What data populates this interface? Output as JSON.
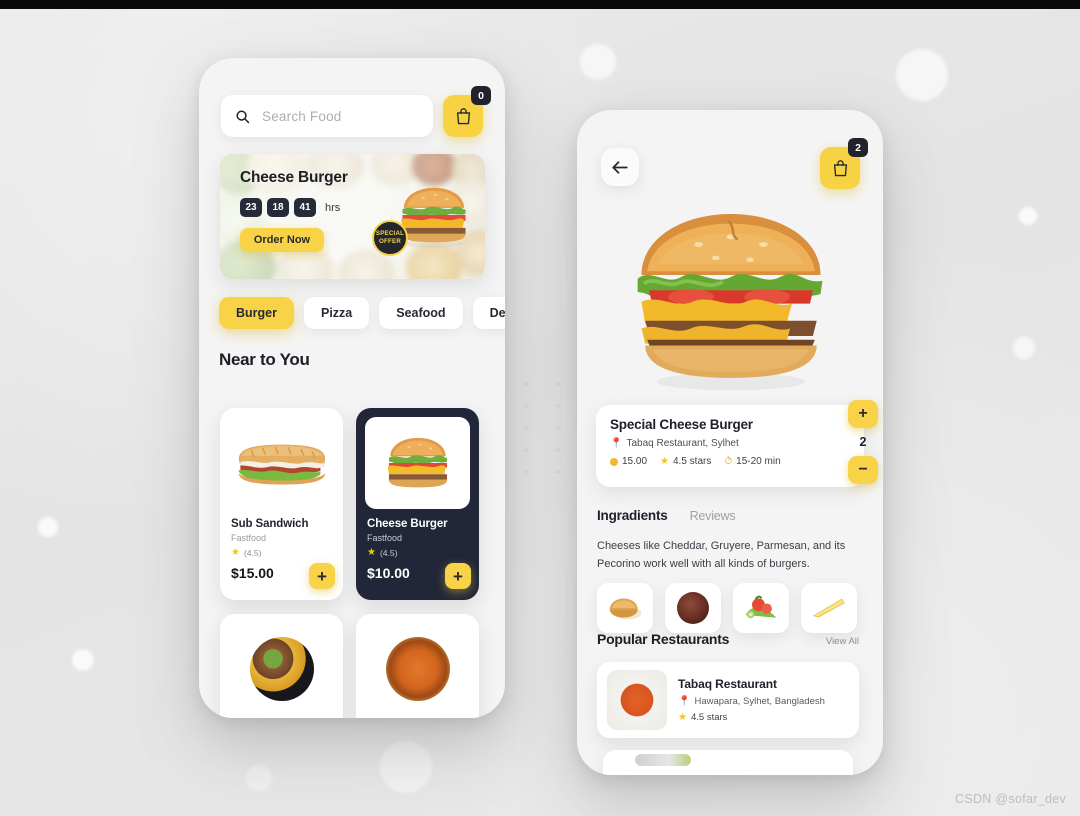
{
  "theme": {
    "accent": "#F8D348",
    "dark": "#212738",
    "bg": "#e6e6e6",
    "pin": "#e8392d",
    "star": "#F5C517"
  },
  "watermark": "CSDN @sofar_dev",
  "left_screen": {
    "search": {
      "placeholder": "Search Food",
      "icon": "search-icon"
    },
    "cart": {
      "icon": "bag-icon",
      "badge": "0"
    },
    "banner": {
      "title": "Cheese Burger",
      "timer": {
        "segments": [
          "23",
          "18",
          "41"
        ],
        "unit": "hrs"
      },
      "cta": "Order Now",
      "offer_line1": "SPECIAL",
      "offer_line2": "OFFER"
    },
    "categories": [
      {
        "label": "Burger",
        "active": true
      },
      {
        "label": "Pizza",
        "active": false
      },
      {
        "label": "Seafood",
        "active": false
      },
      {
        "label": "Dessert",
        "active": false
      }
    ],
    "section_title": "Near to You",
    "food_cards": [
      {
        "name": "Sub Sandwich",
        "category": "Fastfood",
        "rating": "(4.5)",
        "price": "$15.00",
        "add": "+",
        "theme": "light"
      },
      {
        "name": "Cheese Burger",
        "category": "Fastfood",
        "rating": "(4.5)",
        "price": "$10.00",
        "add": "+",
        "theme": "dark"
      }
    ]
  },
  "right_screen": {
    "back": {
      "icon": "arrow-left-icon"
    },
    "cart": {
      "icon": "bag-icon",
      "badge": "2"
    },
    "product": {
      "title": "Special Cheese Burger",
      "location": "Tabaq Restaurant, Sylhet",
      "price": "15.00",
      "rating": "4.5 stars",
      "time": "15-20 min",
      "qty": "2",
      "increase": "+",
      "decrease": "−"
    },
    "tabs": [
      {
        "label": "Ingradients",
        "active": true
      },
      {
        "label": "Reviews",
        "active": false
      }
    ],
    "description": "Cheeses like Cheddar, Gruyere, Parmesan, and its Pecorino work well with all kinds of burgers.",
    "ingredients": [
      "bun-icon",
      "patty-icon",
      "veggies-icon",
      "cheese-icon"
    ],
    "popular": {
      "title": "Popular Restaurants",
      "view_all": "View All"
    },
    "restaurants": [
      {
        "name": "Tabaq Restaurant",
        "location": "Hawapara, Sylhet, Bangladesh",
        "rating": "4.5 stars"
      }
    ]
  }
}
